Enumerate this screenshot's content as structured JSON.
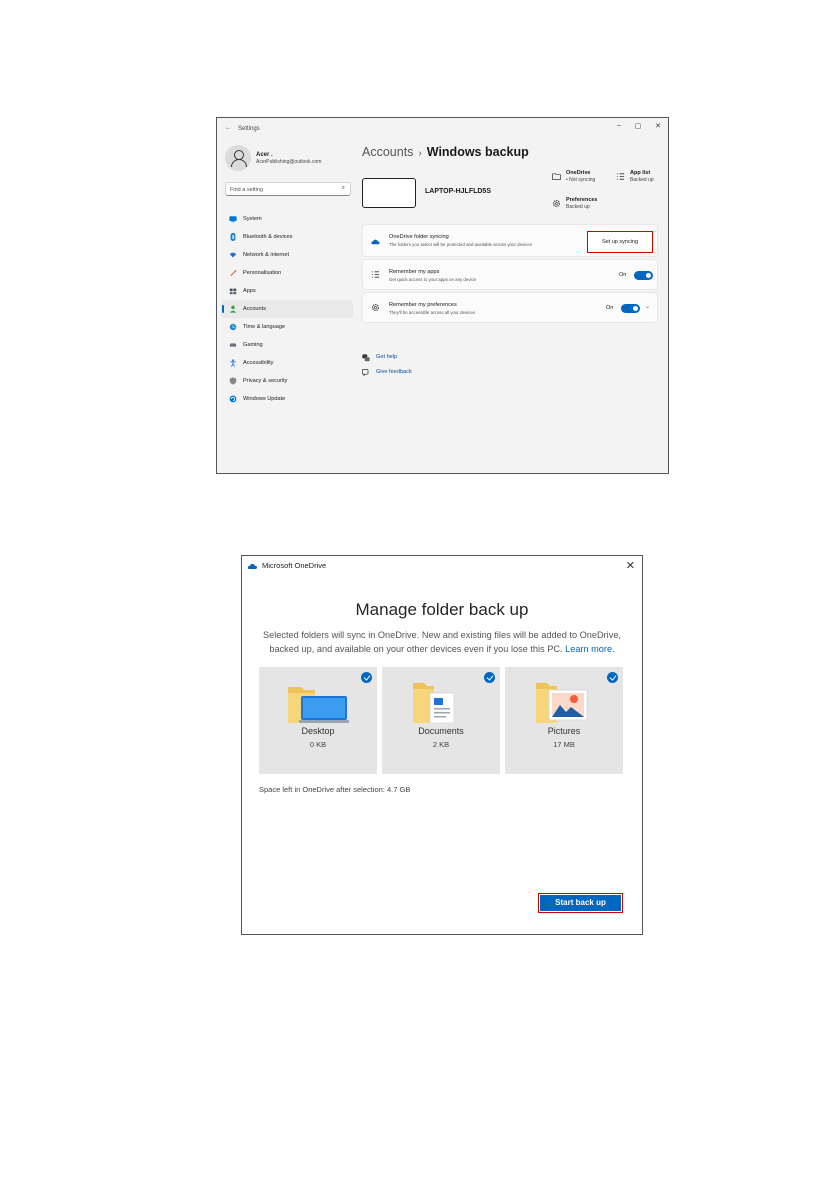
{
  "settings": {
    "title": "Settings",
    "profile": {
      "name": "Acer .",
      "email": "AcerPublishing@outlook.com"
    },
    "search": {
      "placeholder": "Find a setting"
    },
    "nav": [
      {
        "label": "System",
        "icon": "monitor-icon",
        "color": "#0078d4"
      },
      {
        "label": "Bluetooth & devices",
        "icon": "bluetooth-icon",
        "color": "#0078d4"
      },
      {
        "label": "Network & internet",
        "icon": "wifi-icon",
        "color": "#1e6fd9"
      },
      {
        "label": "Personalisation",
        "icon": "brush-icon",
        "color": "#d86a2c"
      },
      {
        "label": "Apps",
        "icon": "apps-icon",
        "color": "#444c5a"
      },
      {
        "label": "Accounts",
        "icon": "person-icon",
        "color": "#2fa34c"
      },
      {
        "label": "Time & language",
        "icon": "globe-clock-icon",
        "color": "#1e88c8"
      },
      {
        "label": "Gaming",
        "icon": "gamepad-icon",
        "color": "#6b7280"
      },
      {
        "label": "Accessibility",
        "icon": "accessibility-icon",
        "color": "#1e6fd9"
      },
      {
        "label": "Privacy & security",
        "icon": "shield-icon",
        "color": "#888888"
      },
      {
        "label": "Windows Update",
        "icon": "update-icon",
        "color": "#0078d4"
      }
    ],
    "active_nav": "Accounts",
    "breadcrumb": {
      "parent": "Accounts",
      "separator": "›",
      "current": "Windows backup"
    },
    "device_name": "LAPTOP-HJLFLD5S",
    "status": {
      "onedrive": {
        "title": "OneDrive",
        "sub": "• Not syncing"
      },
      "applist": {
        "title": "App list",
        "sub": "Backed up"
      },
      "preferences": {
        "title": "Preferences",
        "sub": "Backed up"
      }
    },
    "cards": {
      "onedrive": {
        "title": "OneDrive folder syncing",
        "sub": "The folders you select will be protected and available across your devices",
        "button": "Set up syncing"
      },
      "apps": {
        "title": "Remember my apps",
        "sub": "Get quick access to your apps on any device",
        "state": "On"
      },
      "prefs": {
        "title": "Remember my preferences",
        "sub": "They'll be accessible across all your devices",
        "state": "On"
      }
    },
    "links": {
      "help": "Get help",
      "feedback": "Give feedback"
    },
    "window_controls": {
      "minimize": "–",
      "maximize": "▢",
      "close": "✕"
    }
  },
  "onedrive": {
    "title": "Microsoft OneDrive",
    "close": "✕",
    "heading": "Manage folder back up",
    "description": "Selected folders will sync in OneDrive. New and existing files will be added to OneDrive, backed up, and available on your other devices even if you lose this PC.",
    "learn_more": "Learn more.",
    "folders": [
      {
        "name": "Desktop",
        "size": "0 KB",
        "icon": "desktop-folder-icon",
        "selected": true
      },
      {
        "name": "Documents",
        "size": "2 KB",
        "icon": "documents-folder-icon",
        "selected": true
      },
      {
        "name": "Pictures",
        "size": "17 MB",
        "icon": "pictures-folder-icon",
        "selected": true
      }
    ],
    "space_left": "Space left in OneDrive after selection: 4.7 GB",
    "start_button": "Start back up",
    "accent": "#0067c0",
    "highlight": "#d40000"
  }
}
